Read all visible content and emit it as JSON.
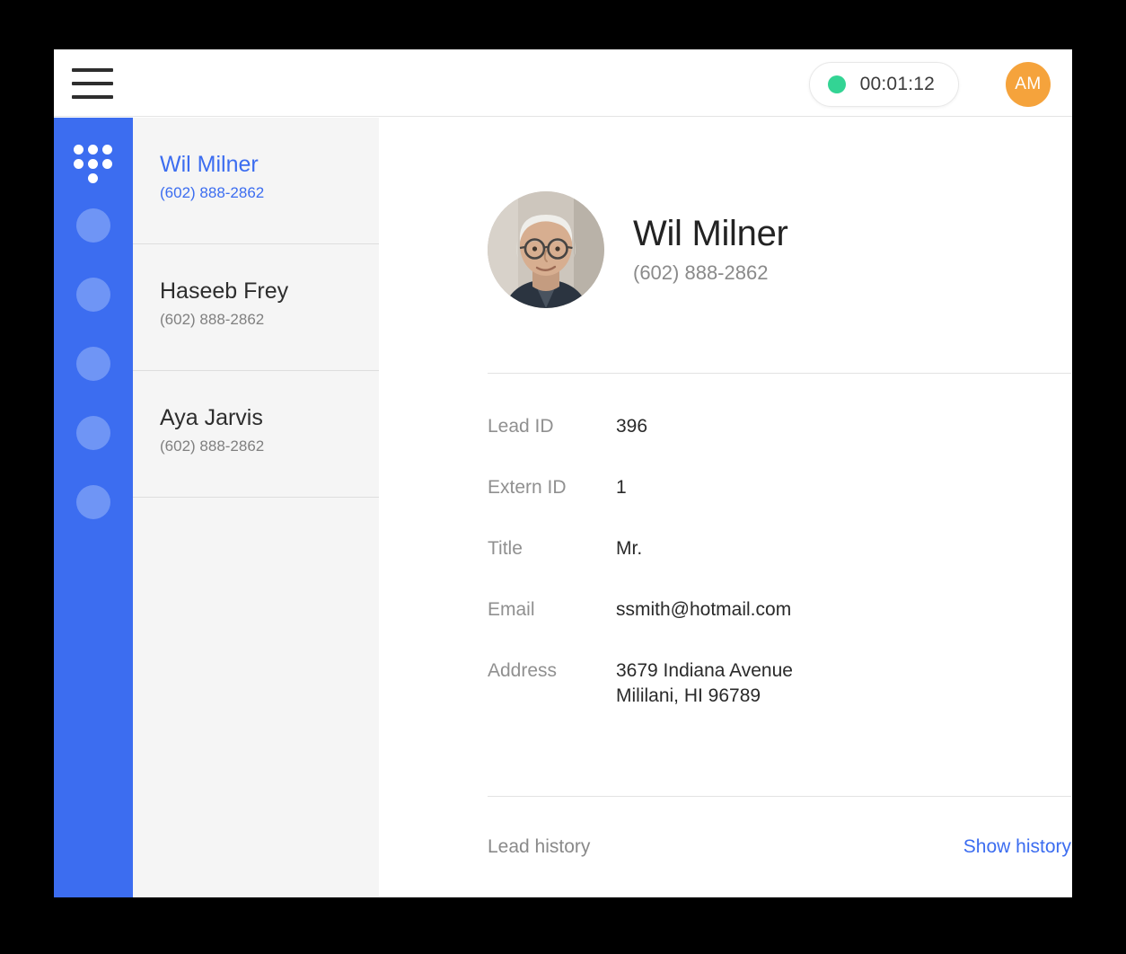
{
  "topbar": {
    "menu_icon": "hamburger-icon",
    "timer": {
      "status_icon": "status-dot-icon",
      "status_color": "#33d494",
      "value": "00:01:12"
    },
    "avatar": {
      "initials": "AM",
      "color": "#f5a33c"
    }
  },
  "rail": {
    "color": "#3c6df0",
    "dialpad_icon": "dialpad-icon",
    "dot_color": "#6f95f5",
    "dot_count": 5
  },
  "contacts": [
    {
      "name": "Wil Milner",
      "phone": "(602) 888-2862",
      "active": true
    },
    {
      "name": "Haseeb Frey",
      "phone": "(602) 888-2862",
      "active": false
    },
    {
      "name": "Aya Jarvis",
      "phone": "(602) 888-2862",
      "active": false
    }
  ],
  "detail": {
    "name": "Wil Milner",
    "phone": "(602) 888-2862",
    "fields": [
      {
        "label": "Lead ID",
        "value": "396"
      },
      {
        "label": "Extern ID",
        "value": "1"
      },
      {
        "label": "Title",
        "value": "Mr."
      },
      {
        "label": "Email",
        "value": "ssmith@hotmail.com"
      },
      {
        "label": "Address",
        "value": "3679 Indiana Avenue\nMililani, HI 96789"
      }
    ],
    "history": {
      "label": "Lead history",
      "link": "Show history",
      "link_color": "#3c6df0"
    }
  }
}
